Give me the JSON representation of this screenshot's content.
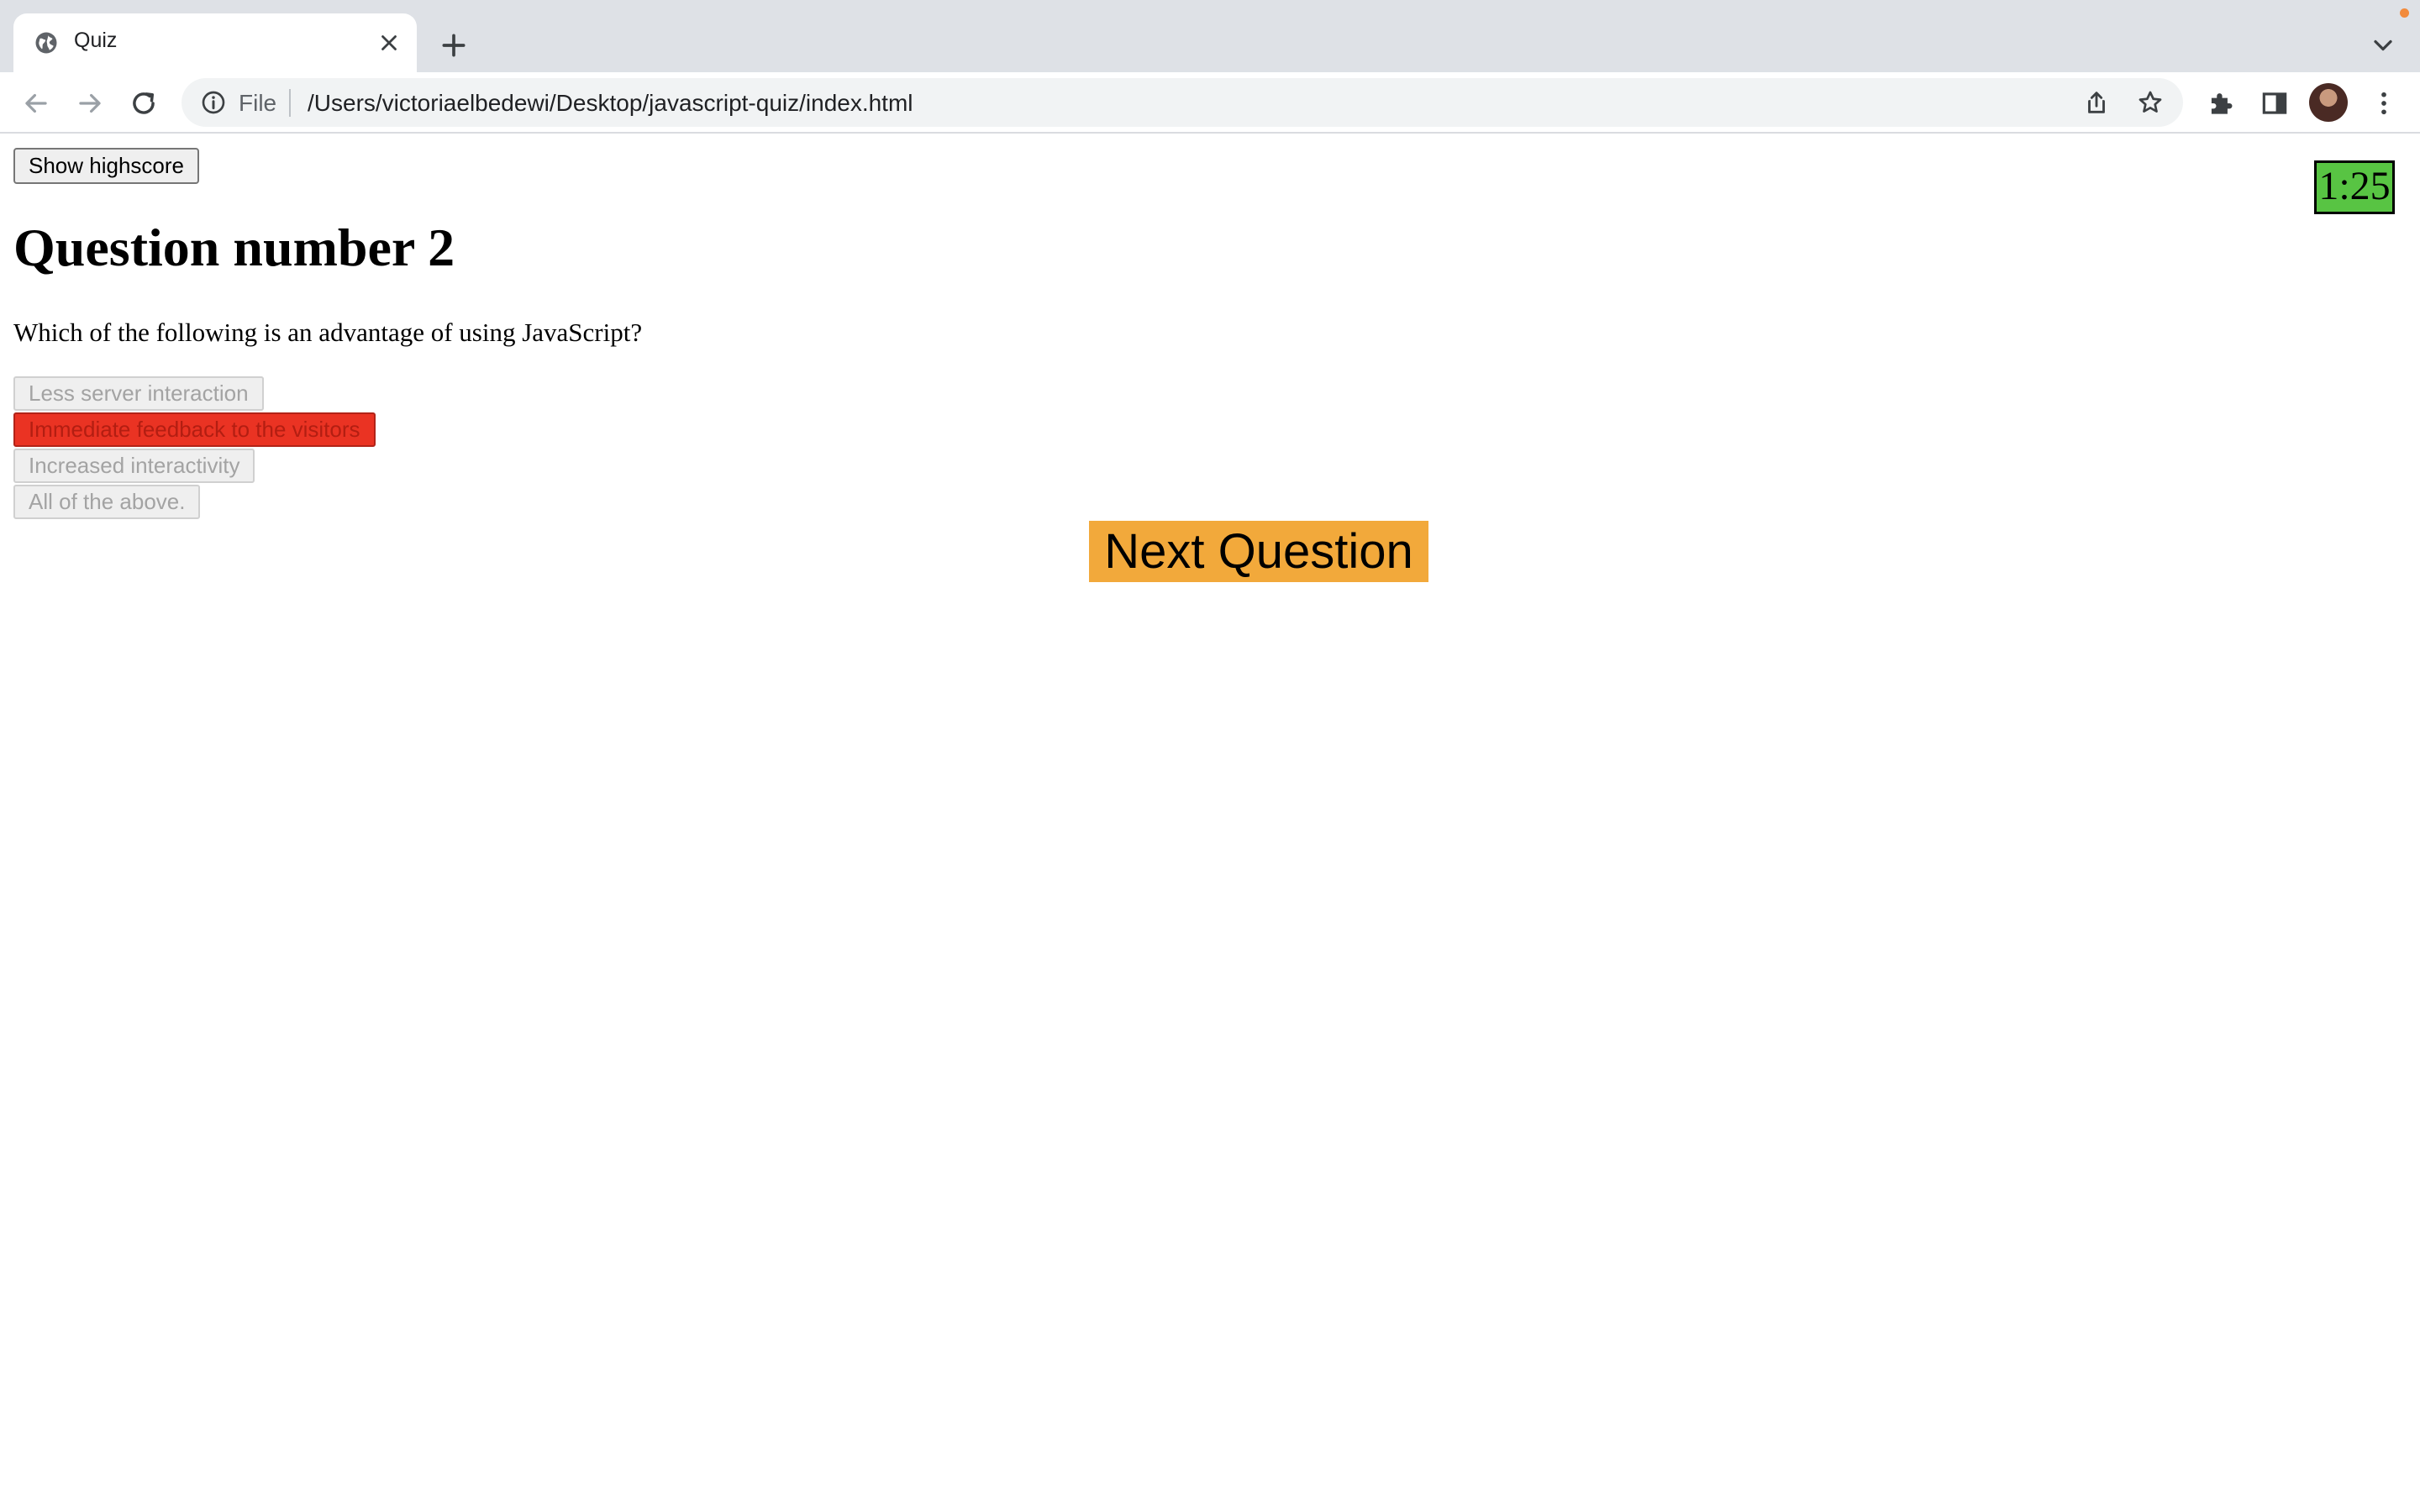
{
  "browser": {
    "tab_title": "Quiz",
    "address_scheme": "File",
    "address_url": "/Users/victoriaelbedewi/Desktop/javascript-quiz/index.html",
    "colors": {
      "tabstrip_bg": "#dee1e6",
      "omnibox_bg": "#f1f3f4",
      "notification_dot": "#f28b3c"
    },
    "icons": [
      "globe-icon",
      "close-icon",
      "plus-icon",
      "chevron-down-icon",
      "back-arrow-icon",
      "forward-arrow-icon",
      "reload-icon",
      "info-icon",
      "share-icon",
      "star-icon",
      "puzzle-icon",
      "side-panel-icon",
      "kebab-menu-icon"
    ]
  },
  "quiz": {
    "highscore_button": "Show highscore",
    "timer": "1:25",
    "heading": "Question number 2",
    "question": "Which of the following is an advantage of using JavaScript?",
    "answers": [
      {
        "label": "Less server interaction",
        "state": "disabled"
      },
      {
        "label": "Immediate feedback to the visitors",
        "state": "wrong"
      },
      {
        "label": "Increased interactivity",
        "state": "disabled"
      },
      {
        "label": "All of the above.",
        "state": "disabled"
      }
    ],
    "next_button": "Next Question",
    "colors": {
      "timer_bg": "#58c443",
      "wrong_answer_bg": "#ea3323",
      "next_button_bg": "#f2a93b"
    }
  }
}
